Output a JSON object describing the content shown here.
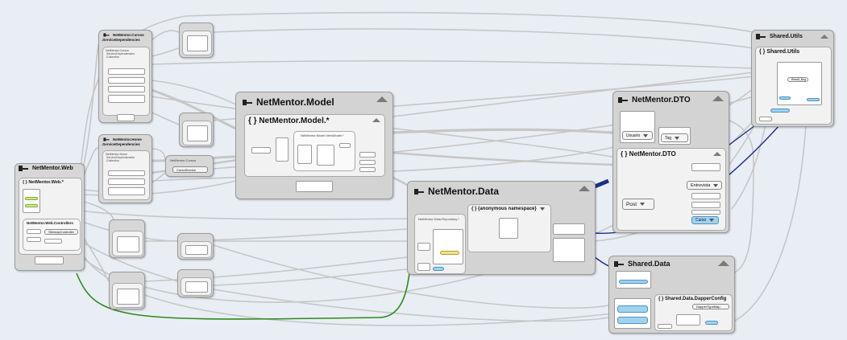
{
  "diagram": {
    "assemblies": {
      "web": {
        "name": "NetMentor.Web",
        "ns": "{ } NetMentor.Web.*",
        "controllers": "NetMentor.Web.Controllers",
        "controller_class": "SitemapController"
      },
      "model": {
        "name": "NetMentor.Model",
        "ns": "{ } NetMentor.Model.*",
        "sub_ns": "NetMentor.Model.ViewModel.*"
      },
      "data": {
        "name": "NetMentor.Data",
        "ns_repo": "NetMentor.Data.Repository.*",
        "ns_anon": "{ } {anonymous namespace}"
      },
      "dto": {
        "name": "NetMentor.DTO",
        "ns": "{ } NetMentor.DTO",
        "classes": [
          "Usuario",
          "Tag",
          "Entrevista",
          "Post",
          "Curso"
        ]
      },
      "utils": {
        "name": "Shared.Utils",
        "ns": "{ } Shared.Utils",
        "class_label": "Result_Bug"
      },
      "shared_data": {
        "name": "Shared.Data",
        "ns": "{ } Shared.Data.DapperConfig",
        "class_label": "DapperTypeMap"
      },
      "cursos_deps": {
        "label_a": "NetMentor.Cursos",
        "label_b": ".ServiceDependencies",
        "inner": "NetMentor.Cursos .ServiceDependencies .Collection"
      },
      "home_deps": {
        "label_a": "NetMentor.Home",
        "label_b": ".ServiceDependencies",
        "inner": "NetMentor.Home .ServiceDependencies .Collection"
      },
      "cursos": {
        "label": "NetMentor.Cursos",
        "class_label": "CursoService"
      }
    },
    "colors": {
      "background": "#e9eef5",
      "node": "#d7d7d7",
      "edge": "#c9c9c9",
      "edge_dark": "#1d2e8c",
      "edge_green": "#2e8b1a",
      "class_blue": "#9fd3ee",
      "class_yellow": "#f6e08a",
      "class_green": "#c8ef86"
    }
  }
}
